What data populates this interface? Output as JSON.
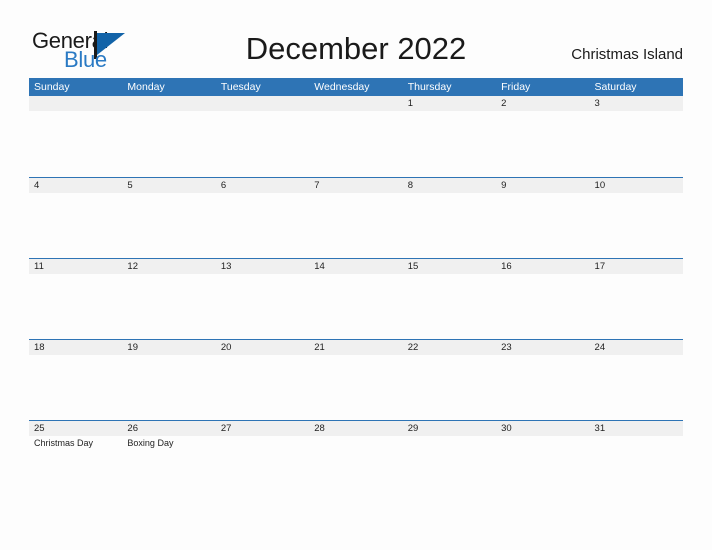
{
  "brand": {
    "name_part1": "General",
    "name_part2": "Blue",
    "mark_icon": "triangle-flag-icon",
    "color_blue": "#1263a8",
    "color_text": "#2a7ac4"
  },
  "header": {
    "title": "December 2022",
    "location": "Christmas Island"
  },
  "theme": {
    "header_blue": "#2e74b5",
    "band_gray": "#f0f0f0",
    "page_background": "#fdfdfd",
    "text_color": "#1f1f1f"
  },
  "calendar": {
    "month": "December",
    "year": "2022",
    "weekday_headers": [
      "Sunday",
      "Monday",
      "Tuesday",
      "Wednesday",
      "Thursday",
      "Friday",
      "Saturday"
    ],
    "weeks": [
      {
        "days": [
          {
            "num": "",
            "events": []
          },
          {
            "num": "",
            "events": []
          },
          {
            "num": "",
            "events": []
          },
          {
            "num": "",
            "events": []
          },
          {
            "num": "1",
            "events": []
          },
          {
            "num": "2",
            "events": []
          },
          {
            "num": "3",
            "events": []
          }
        ]
      },
      {
        "days": [
          {
            "num": "4",
            "events": []
          },
          {
            "num": "5",
            "events": []
          },
          {
            "num": "6",
            "events": []
          },
          {
            "num": "7",
            "events": []
          },
          {
            "num": "8",
            "events": []
          },
          {
            "num": "9",
            "events": []
          },
          {
            "num": "10",
            "events": []
          }
        ]
      },
      {
        "days": [
          {
            "num": "11",
            "events": []
          },
          {
            "num": "12",
            "events": []
          },
          {
            "num": "13",
            "events": []
          },
          {
            "num": "14",
            "events": []
          },
          {
            "num": "15",
            "events": []
          },
          {
            "num": "16",
            "events": []
          },
          {
            "num": "17",
            "events": []
          }
        ]
      },
      {
        "days": [
          {
            "num": "18",
            "events": []
          },
          {
            "num": "19",
            "events": []
          },
          {
            "num": "20",
            "events": []
          },
          {
            "num": "21",
            "events": []
          },
          {
            "num": "22",
            "events": []
          },
          {
            "num": "23",
            "events": []
          },
          {
            "num": "24",
            "events": []
          }
        ]
      },
      {
        "days": [
          {
            "num": "25",
            "events": [
              "Christmas Day"
            ]
          },
          {
            "num": "26",
            "events": [
              "Boxing Day"
            ]
          },
          {
            "num": "27",
            "events": []
          },
          {
            "num": "28",
            "events": []
          },
          {
            "num": "29",
            "events": []
          },
          {
            "num": "30",
            "events": []
          },
          {
            "num": "31",
            "events": []
          }
        ]
      }
    ]
  }
}
